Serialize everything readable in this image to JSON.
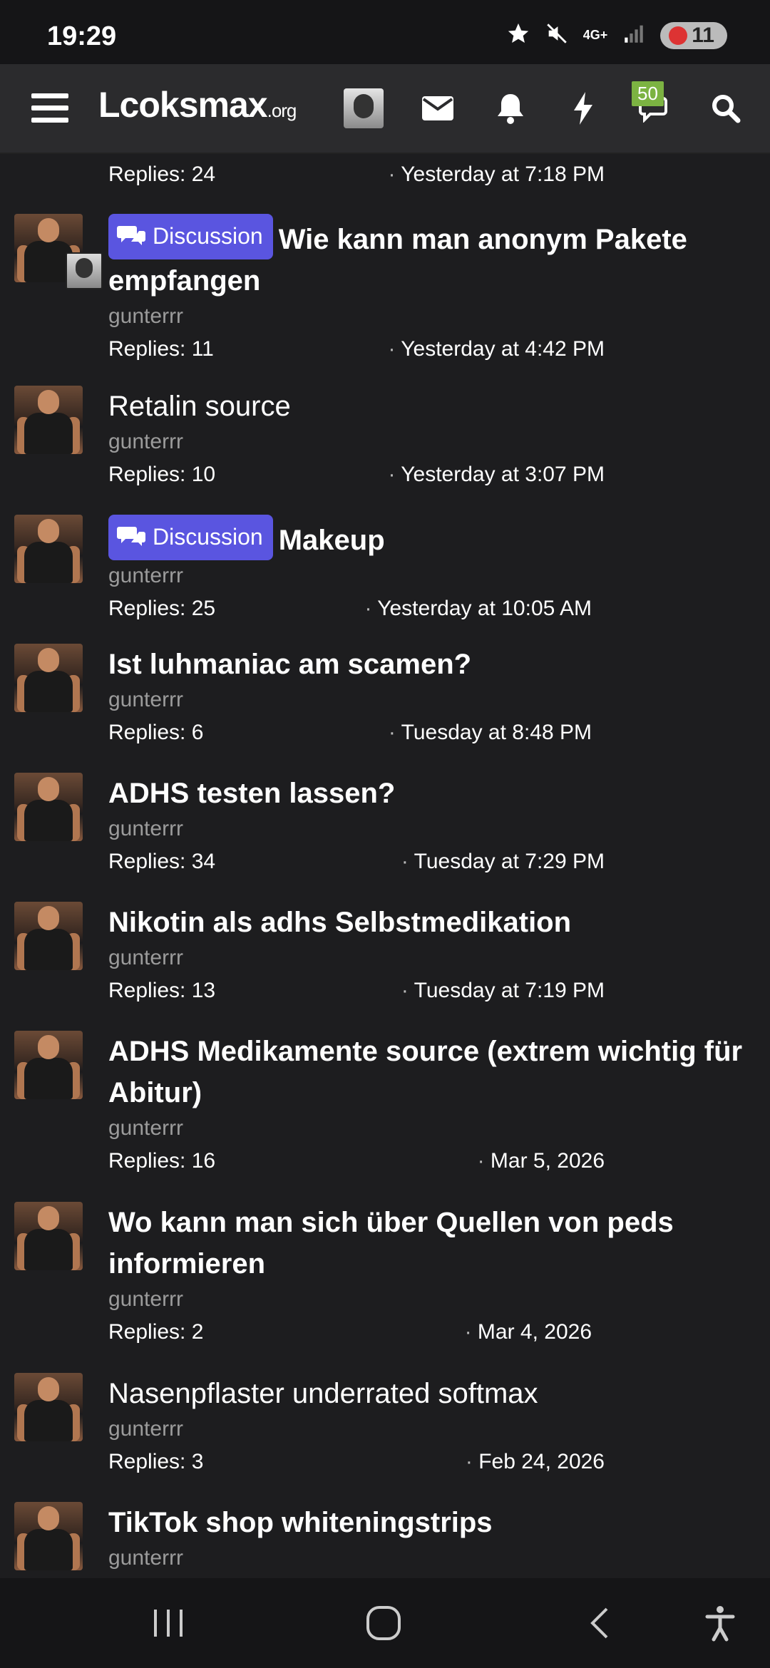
{
  "status": {
    "time": "19:29",
    "network": "4G+",
    "battery": "11"
  },
  "nav": {
    "logo_main": "Lcoksmax",
    "logo_suffix": ".org",
    "alerts_badge": "50"
  },
  "threads": [
    {
      "prefix": "",
      "title": "",
      "author": "",
      "replies": "Replies: 24",
      "date": "Yesterday at 7:18 PM"
    },
    {
      "prefix": "Discussion",
      "title": "Wie kann man anonym Pakete empfangen",
      "author": "gunterrr",
      "replies": "Replies: 11",
      "date": "Yesterday at 4:42 PM"
    },
    {
      "prefix": "",
      "title": "Retalin source",
      "author": "gunterrr",
      "replies": "Replies: 10",
      "date": "Yesterday at 3:07 PM"
    },
    {
      "prefix": "Discussion",
      "title": "Makeup",
      "author": "gunterrr",
      "replies": "Replies: 25",
      "date": "Yesterday at 10:05 AM"
    },
    {
      "prefix": "",
      "title": "Ist luhmaniac am scamen?",
      "author": "gunterrr",
      "replies": "Replies: 6",
      "date": "Tuesday at 8:48 PM"
    },
    {
      "prefix": "",
      "title": "ADHS testen lassen?",
      "author": "gunterrr",
      "replies": "Replies: 34",
      "date": "Tuesday at 7:29 PM"
    },
    {
      "prefix": "",
      "title": "Nikotin als adhs Selbstmedikation",
      "author": "gunterrr",
      "replies": "Replies: 13",
      "date": "Tuesday at 7:19 PM"
    },
    {
      "prefix": "",
      "title": "ADHS Medikamente source (extrem wichtig für Abitur)",
      "author": "gunterrr",
      "replies": "Replies: 16",
      "date": "Mar 5, 2026"
    },
    {
      "prefix": "",
      "title": "Wo kann man sich über Quellen von peds informieren",
      "author": "gunterrr",
      "replies": "Replies: 2",
      "date": "Mar 4, 2026"
    },
    {
      "prefix": "",
      "title": "Nasenpflaster underrated softmax",
      "author": "gunterrr",
      "replies": "Replies: 3",
      "date": "Feb 24, 2026"
    },
    {
      "prefix": "",
      "title": "TikTok shop whiteningstrips",
      "author": "gunterrr",
      "replies": "",
      "date": ""
    }
  ],
  "icons": {
    "menu": "hamburger-icon",
    "inbox": "envelope-icon",
    "alerts": "bell-icon",
    "whatsnew": "bolt-icon",
    "conversations": "chat-icon",
    "search": "search-icon"
  },
  "colors": {
    "prefix_bg": "#5a55e0",
    "badge_bg": "#7cb342",
    "background": "#1d1d1f"
  }
}
